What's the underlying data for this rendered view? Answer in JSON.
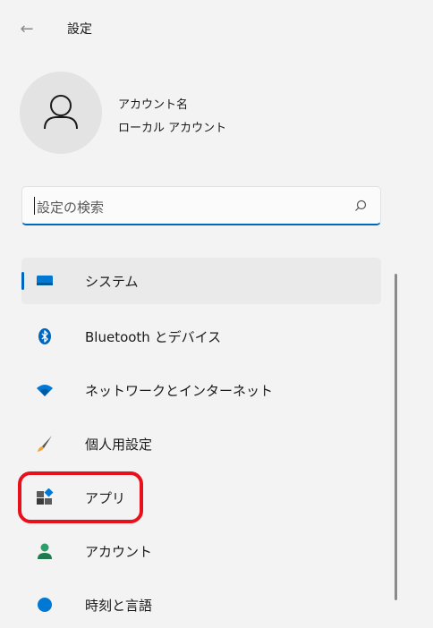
{
  "header": {
    "back_icon": "back-arrow-icon",
    "title": "設定"
  },
  "account": {
    "avatar_icon": "person-icon",
    "name": "アカウント名",
    "type": "ローカル アカウント"
  },
  "search": {
    "value": "設定の検索",
    "icon": "search-icon"
  },
  "nav": {
    "items": [
      {
        "label": "システム",
        "icon": "monitor-icon",
        "selected": true
      },
      {
        "label": "Bluetooth とデバイス",
        "icon": "bluetooth-icon"
      },
      {
        "label": "ネットワークとインターネット",
        "icon": "wifi-icon"
      },
      {
        "label": "個人用設定",
        "icon": "brush-icon"
      },
      {
        "label": "アプリ",
        "icon": "apps-icon"
      },
      {
        "label": "アカウント",
        "icon": "account-icon"
      },
      {
        "label": "時刻と言語",
        "icon": "globe-clock-icon"
      }
    ]
  },
  "annotation": {
    "highlight_color": "#e8101a"
  },
  "colors": {
    "accent": "#0067c0",
    "background": "#f3f3f3"
  }
}
